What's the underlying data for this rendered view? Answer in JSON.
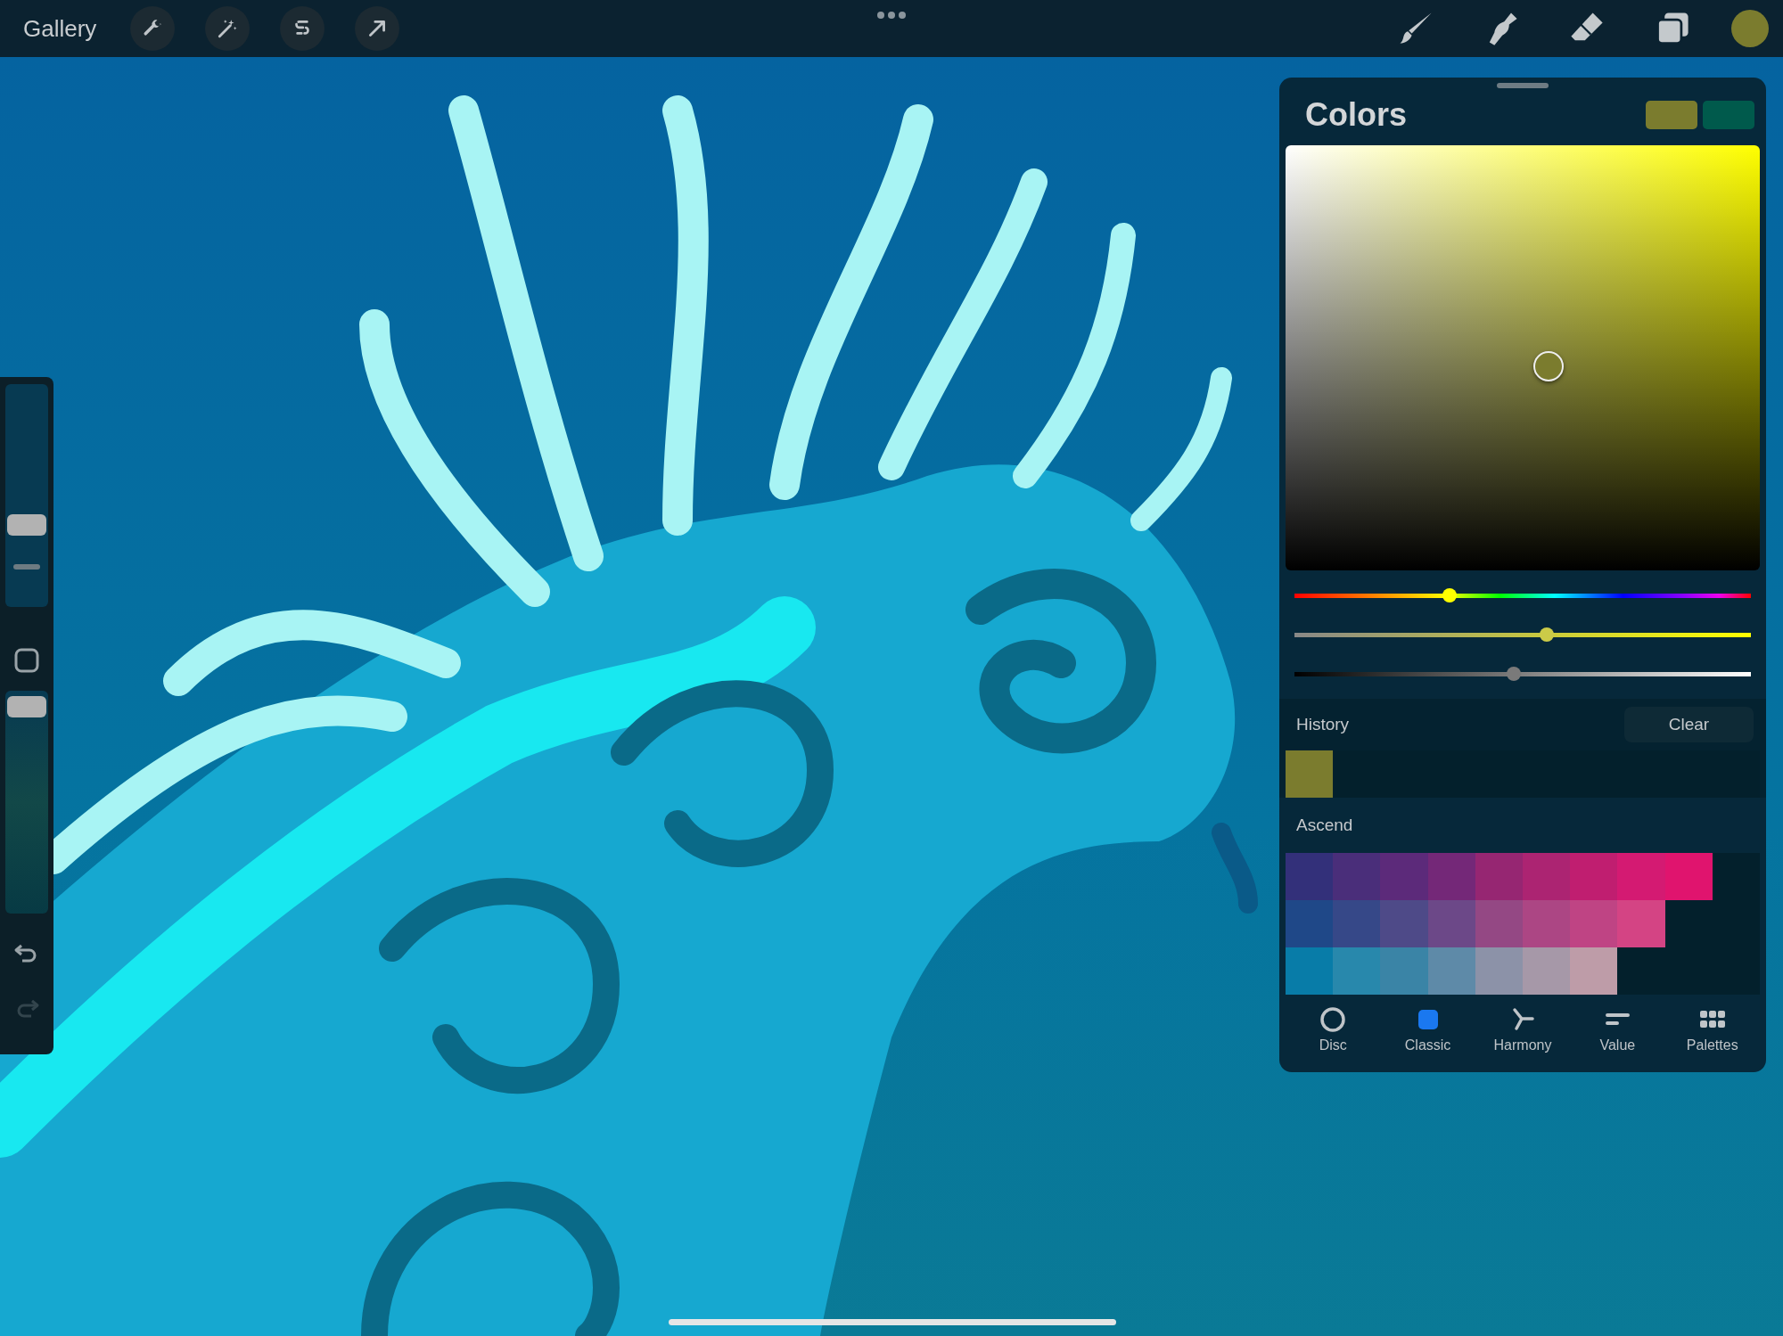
{
  "top_bar": {
    "gallery": "Gallery",
    "current_color": {
      "color": "#7b7c2e"
    }
  },
  "sidebar": {
    "brush_size": {
      "level": 0.37
    },
    "opacity": {
      "level": 0.93
    },
    "redo": {
      "disabled": true
    },
    "undo": {
      "disabled": false
    }
  },
  "colors": {
    "title": "Colors",
    "primary": {
      "color": "#7b7c2e"
    },
    "secondary": {
      "color": "#005a4c"
    },
    "hue": {
      "level": 0.335
    },
    "saturation": {
      "level": 0.555
    },
    "brightness": {
      "level": 0.48
    },
    "history": {
      "label": "History",
      "clear": "Clear",
      "swatches": [
        {
          "color": "#7b7c2e"
        }
      ]
    },
    "palette": {
      "name": "Ascend",
      "rows": [
        {
          "swatches": [
            {
              "color": "#33307a"
            },
            {
              "color": "#4a2e7a"
            },
            {
              "color": "#5c2a7a"
            },
            {
              "color": "#742878"
            },
            {
              "color": "#962672"
            },
            {
              "color": "#ac2472"
            },
            {
              "color": "#c01e70"
            },
            {
              "color": "#d41a72"
            },
            {
              "color": "#e0146e"
            }
          ]
        },
        {
          "swatches": [
            {
              "color": "#1f4888"
            },
            {
              "color": "#364888"
            },
            {
              "color": "#4e4a88"
            },
            {
              "color": "#6c4888"
            },
            {
              "color": "#944884"
            },
            {
              "color": "#ac4684"
            },
            {
              "color": "#bf4484"
            },
            {
              "color": "#d44484"
            }
          ]
        },
        {
          "swatches": [
            {
              "color": "#087ca8"
            },
            {
              "color": "#2888ac"
            },
            {
              "color": "#3a84a6"
            },
            {
              "color": "#5e8aa8"
            },
            {
              "color": "#8c92a8"
            },
            {
              "color": "#a698a8"
            },
            {
              "color": "#be9ca8"
            }
          ]
        }
      ]
    },
    "tabs": [
      {
        "kind": "disc",
        "label": "Disc",
        "selected": false
      },
      {
        "kind": "classic",
        "label": "Classic",
        "selected": true
      },
      {
        "kind": "harmony",
        "label": "Harmony",
        "selected": false
      },
      {
        "kind": "value",
        "label": "Value",
        "selected": false
      },
      {
        "kind": "palettes",
        "label": "Palettes",
        "selected": false
      }
    ]
  }
}
